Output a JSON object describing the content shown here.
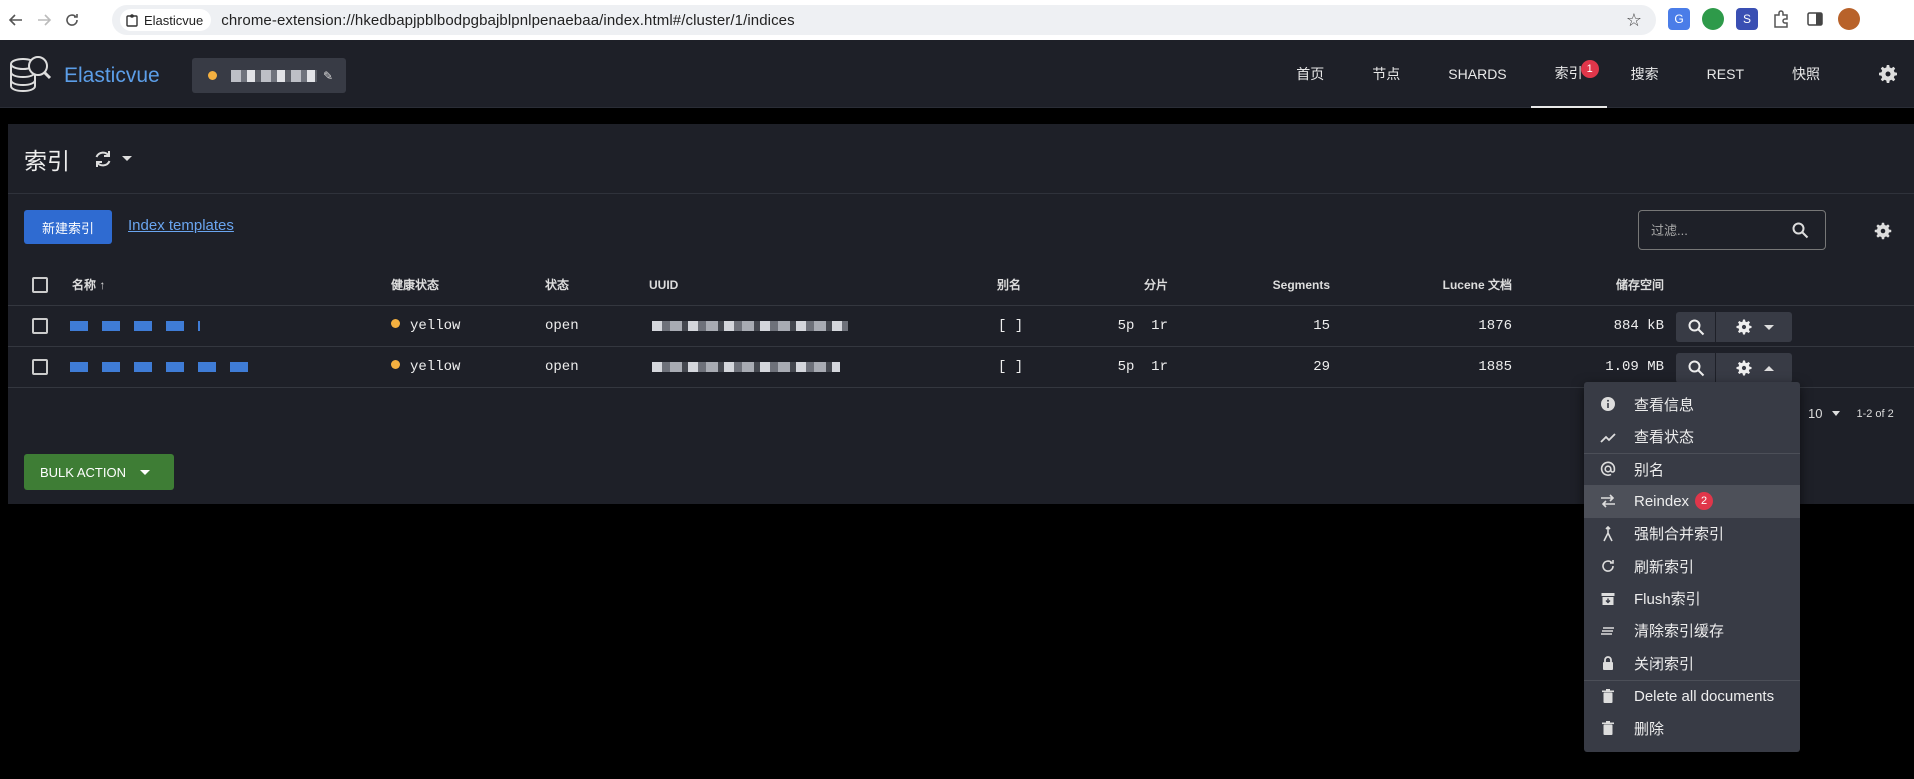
{
  "browser": {
    "tab_chip": "Elasticvue",
    "url": "chrome-extension://hkedbapjpblbodpgbajblpnlpenaebaa/index.html#/cluster/1/indices"
  },
  "app": {
    "name": "Elasticvue",
    "nav": [
      {
        "label": "首页"
      },
      {
        "label": "节点"
      },
      {
        "label": "SHARDS"
      },
      {
        "label": "索引",
        "badge": "1",
        "active": true
      },
      {
        "label": "搜索"
      },
      {
        "label": "REST"
      },
      {
        "label": "快照"
      }
    ]
  },
  "page": {
    "title": "索引",
    "new_index_button": "新建索引",
    "index_templates_link": "Index templates",
    "filter_placeholder": "过滤...",
    "bulk_action": "BULK ACTION"
  },
  "table": {
    "columns": [
      "名称",
      "健康状态",
      "状态",
      "UUID",
      "别名",
      "分片",
      "Segments",
      "Lucene 文档",
      "储存空间"
    ],
    "rows": [
      {
        "health": "yellow",
        "status": "open",
        "aliases": "[ ]",
        "shards": "5p  1r",
        "segments": "15",
        "docs": "1876",
        "storage": "884 kB"
      },
      {
        "health": "yellow",
        "status": "open",
        "aliases": "[ ]",
        "shards": "5p  1r",
        "segments": "29",
        "docs": "1885",
        "storage": "1.09 MB"
      }
    ]
  },
  "pagination": {
    "per_page": "10",
    "range": "1-2 of 2"
  },
  "menu": {
    "items": [
      {
        "label": "查看信息",
        "icon": "info-icon"
      },
      {
        "label": "查看状态",
        "icon": "chart-line-icon"
      },
      {
        "label": "别名",
        "icon": "at-icon"
      },
      {
        "label": "Reindex",
        "icon": "swap-icon",
        "badge": "2"
      },
      {
        "label": "强制合并索引",
        "icon": "merge-icon"
      },
      {
        "label": "刷新索引",
        "icon": "refresh-icon"
      },
      {
        "label": "Flush索引",
        "icon": "archive-icon"
      },
      {
        "label": "清除索引缓存",
        "icon": "clear-cache-icon"
      },
      {
        "label": "关闭索引",
        "icon": "lock-icon"
      },
      {
        "label": "Delete all documents",
        "icon": "trash-icon"
      },
      {
        "label": "删除",
        "icon": "trash-icon"
      }
    ]
  },
  "colors": {
    "accent": "#2f6bd1",
    "brand": "#5c9ee8",
    "health_yellow": "#f4b040",
    "badge_red": "#e0364a",
    "bulk_green": "#3e7d35"
  }
}
